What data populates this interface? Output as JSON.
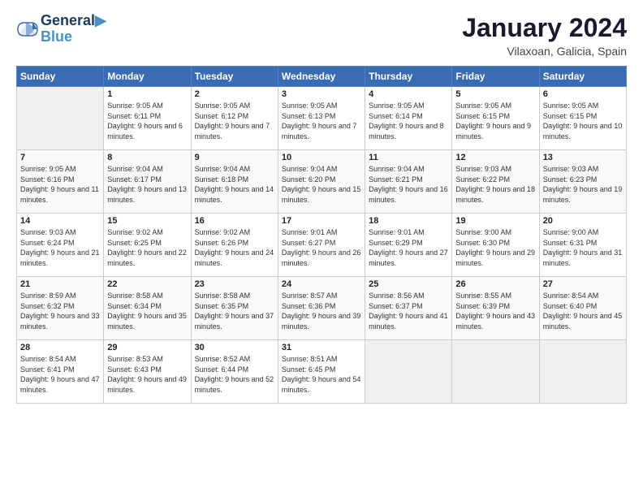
{
  "header": {
    "logo_line1": "General",
    "logo_line2": "Blue",
    "month": "January 2024",
    "location": "Vilaxoan, Galicia, Spain"
  },
  "days_of_week": [
    "Sunday",
    "Monday",
    "Tuesday",
    "Wednesday",
    "Thursday",
    "Friday",
    "Saturday"
  ],
  "weeks": [
    [
      {
        "day": "",
        "empty": true
      },
      {
        "day": "1",
        "sunrise": "9:05 AM",
        "sunset": "6:11 PM",
        "daylight": "9 hours and 6 minutes."
      },
      {
        "day": "2",
        "sunrise": "9:05 AM",
        "sunset": "6:12 PM",
        "daylight": "9 hours and 7 minutes."
      },
      {
        "day": "3",
        "sunrise": "9:05 AM",
        "sunset": "6:13 PM",
        "daylight": "9 hours and 7 minutes."
      },
      {
        "day": "4",
        "sunrise": "9:05 AM",
        "sunset": "6:14 PM",
        "daylight": "9 hours and 8 minutes."
      },
      {
        "day": "5",
        "sunrise": "9:05 AM",
        "sunset": "6:15 PM",
        "daylight": "9 hours and 9 minutes."
      },
      {
        "day": "6",
        "sunrise": "9:05 AM",
        "sunset": "6:15 PM",
        "daylight": "9 hours and 10 minutes."
      }
    ],
    [
      {
        "day": "7",
        "sunrise": "9:05 AM",
        "sunset": "6:16 PM",
        "daylight": "9 hours and 11 minutes."
      },
      {
        "day": "8",
        "sunrise": "9:04 AM",
        "sunset": "6:17 PM",
        "daylight": "9 hours and 13 minutes."
      },
      {
        "day": "9",
        "sunrise": "9:04 AM",
        "sunset": "6:18 PM",
        "daylight": "9 hours and 14 minutes."
      },
      {
        "day": "10",
        "sunrise": "9:04 AM",
        "sunset": "6:20 PM",
        "daylight": "9 hours and 15 minutes."
      },
      {
        "day": "11",
        "sunrise": "9:04 AM",
        "sunset": "6:21 PM",
        "daylight": "9 hours and 16 minutes."
      },
      {
        "day": "12",
        "sunrise": "9:03 AM",
        "sunset": "6:22 PM",
        "daylight": "9 hours and 18 minutes."
      },
      {
        "day": "13",
        "sunrise": "9:03 AM",
        "sunset": "6:23 PM",
        "daylight": "9 hours and 19 minutes."
      }
    ],
    [
      {
        "day": "14",
        "sunrise": "9:03 AM",
        "sunset": "6:24 PM",
        "daylight": "9 hours and 21 minutes."
      },
      {
        "day": "15",
        "sunrise": "9:02 AM",
        "sunset": "6:25 PM",
        "daylight": "9 hours and 22 minutes."
      },
      {
        "day": "16",
        "sunrise": "9:02 AM",
        "sunset": "6:26 PM",
        "daylight": "9 hours and 24 minutes."
      },
      {
        "day": "17",
        "sunrise": "9:01 AM",
        "sunset": "6:27 PM",
        "daylight": "9 hours and 26 minutes."
      },
      {
        "day": "18",
        "sunrise": "9:01 AM",
        "sunset": "6:29 PM",
        "daylight": "9 hours and 27 minutes."
      },
      {
        "day": "19",
        "sunrise": "9:00 AM",
        "sunset": "6:30 PM",
        "daylight": "9 hours and 29 minutes."
      },
      {
        "day": "20",
        "sunrise": "9:00 AM",
        "sunset": "6:31 PM",
        "daylight": "9 hours and 31 minutes."
      }
    ],
    [
      {
        "day": "21",
        "sunrise": "8:59 AM",
        "sunset": "6:32 PM",
        "daylight": "9 hours and 33 minutes."
      },
      {
        "day": "22",
        "sunrise": "8:58 AM",
        "sunset": "6:34 PM",
        "daylight": "9 hours and 35 minutes."
      },
      {
        "day": "23",
        "sunrise": "8:58 AM",
        "sunset": "6:35 PM",
        "daylight": "9 hours and 37 minutes."
      },
      {
        "day": "24",
        "sunrise": "8:57 AM",
        "sunset": "6:36 PM",
        "daylight": "9 hours and 39 minutes."
      },
      {
        "day": "25",
        "sunrise": "8:56 AM",
        "sunset": "6:37 PM",
        "daylight": "9 hours and 41 minutes."
      },
      {
        "day": "26",
        "sunrise": "8:55 AM",
        "sunset": "6:39 PM",
        "daylight": "9 hours and 43 minutes."
      },
      {
        "day": "27",
        "sunrise": "8:54 AM",
        "sunset": "6:40 PM",
        "daylight": "9 hours and 45 minutes."
      }
    ],
    [
      {
        "day": "28",
        "sunrise": "8:54 AM",
        "sunset": "6:41 PM",
        "daylight": "9 hours and 47 minutes."
      },
      {
        "day": "29",
        "sunrise": "8:53 AM",
        "sunset": "6:43 PM",
        "daylight": "9 hours and 49 minutes."
      },
      {
        "day": "30",
        "sunrise": "8:52 AM",
        "sunset": "6:44 PM",
        "daylight": "9 hours and 52 minutes."
      },
      {
        "day": "31",
        "sunrise": "8:51 AM",
        "sunset": "6:45 PM",
        "daylight": "9 hours and 54 minutes."
      },
      {
        "day": "",
        "empty": true
      },
      {
        "day": "",
        "empty": true
      },
      {
        "day": "",
        "empty": true
      }
    ]
  ],
  "labels": {
    "sunrise": "Sunrise:",
    "sunset": "Sunset:",
    "daylight": "Daylight:"
  }
}
